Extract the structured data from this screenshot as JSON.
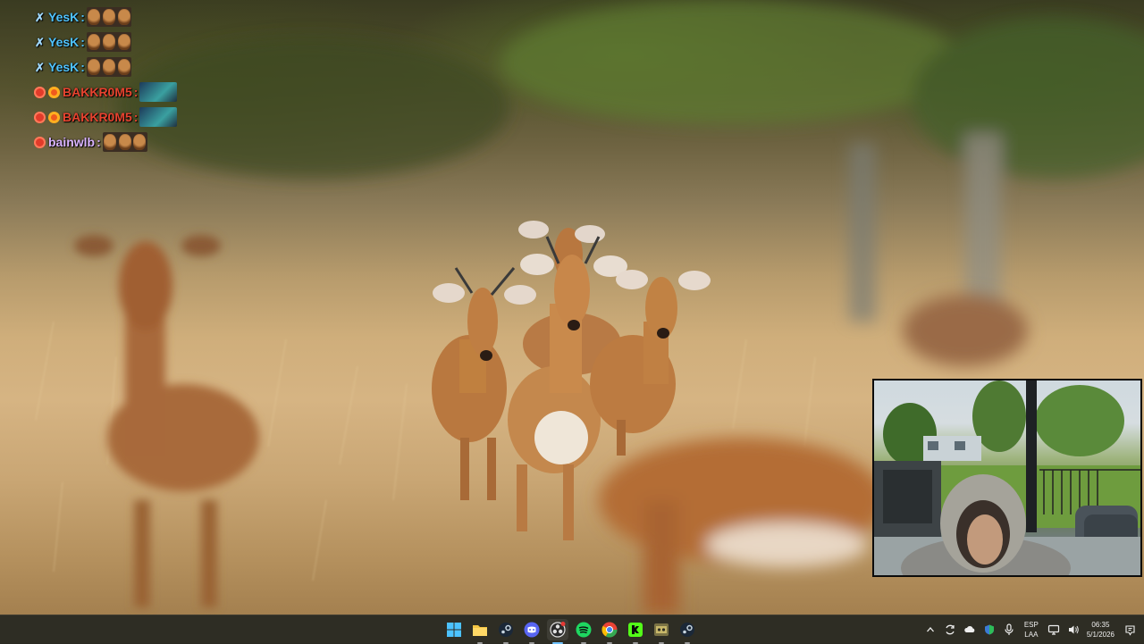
{
  "chat": {
    "messages": [
      {
        "badges": [
          "sword-badge"
        ],
        "user": "YesK",
        "user_color": "#4fc3ff",
        "separator": ":",
        "emote": "emote-three-faces"
      },
      {
        "badges": [
          "sword-badge"
        ],
        "user": "YesK",
        "user_color": "#4fc3ff",
        "separator": ":",
        "emote": "emote-three-faces"
      },
      {
        "badges": [
          "sword-badge"
        ],
        "user": "YesK",
        "user_color": "#4fc3ff",
        "separator": ":",
        "emote": "emote-three-faces"
      },
      {
        "badges": [
          "red-badge",
          "ring-badge"
        ],
        "user": "BAKKR0M5",
        "user_color": "#e8432f",
        "separator": ":",
        "emote": "emote-person-cam"
      },
      {
        "badges": [
          "red-badge",
          "ring-badge"
        ],
        "user": "BAKKR0M5",
        "user_color": "#e8432f",
        "separator": ":",
        "emote": "emote-person-cam"
      },
      {
        "badges": [
          "red-badge"
        ],
        "user": "bainwlb",
        "user_color": "#d9b3ff",
        "separator": ":",
        "emote": "emote-three-faces"
      }
    ]
  },
  "taskbar": {
    "apps": [
      {
        "name": "start-button",
        "icon": "windows-logo-icon",
        "color": "#4cc2ff"
      },
      {
        "name": "file-explorer",
        "icon": "folder-icon",
        "color": "#f4c542"
      },
      {
        "name": "steam",
        "icon": "steam-icon",
        "color": "#c7d5e0"
      },
      {
        "name": "discord",
        "icon": "discord-icon",
        "color": "#5865f2"
      },
      {
        "name": "obs",
        "icon": "obs-icon",
        "color": "#e0e0e0"
      },
      {
        "name": "spotify",
        "icon": "spotify-icon",
        "color": "#1ed760"
      },
      {
        "name": "chrome",
        "icon": "chrome-icon",
        "color": "#e94235"
      },
      {
        "name": "kick",
        "icon": "kick-icon",
        "color": "#53fc18"
      },
      {
        "name": "game-app",
        "icon": "game-controller-icon",
        "color": "#c8b86a"
      },
      {
        "name": "steam-2",
        "icon": "steam-icon",
        "color": "#c7d5e0"
      }
    ],
    "tray": {
      "language": "ESP",
      "layout": "LAA",
      "time": "06:35",
      "date": "5/1/2026"
    }
  }
}
